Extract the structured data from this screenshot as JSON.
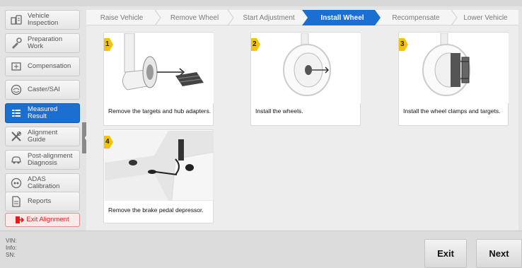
{
  "sidebar": {
    "items": [
      {
        "label": "Vehicle\nInspection",
        "icon": "vehicle-inspection-icon"
      },
      {
        "label": "Preparation\nWork",
        "icon": "preparation-icon"
      },
      {
        "label": "Compensation",
        "icon": "compensation-icon"
      },
      {
        "label": "Caster/SAI",
        "icon": "caster-icon"
      },
      {
        "label": "Measured\nResult",
        "icon": "measured-result-icon"
      },
      {
        "label": "Alignment\nGuide",
        "icon": "alignment-guide-icon"
      },
      {
        "label": "Post-alignment\nDiagnosis",
        "icon": "post-alignment-icon"
      },
      {
        "label": "ADAS\nCalibration",
        "icon": "adas-icon"
      },
      {
        "label": "Reports",
        "icon": "reports-icon"
      }
    ],
    "exit_label": "Exit Alignment",
    "active_index": 4
  },
  "steps": [
    "Raise Vehicle",
    "Remove Wheel",
    "Start Adjustment",
    "Install Wheel",
    "Recompensate",
    "Lower Vehicle"
  ],
  "active_step": 3,
  "cards": [
    {
      "number": "1",
      "text": "Remove the targets and hub adapters."
    },
    {
      "number": "2",
      "text": "Install the wheels."
    },
    {
      "number": "3",
      "text": "Install the wheel clamps and targets."
    },
    {
      "number": "4",
      "text": "Remove the brake pedal depressor."
    }
  ],
  "footer": {
    "vin_label": "VIN:",
    "info_label": "Info:",
    "sn_label": "SN:",
    "exit_button": "Exit",
    "next_button": "Next"
  },
  "colors": {
    "accent": "#1a6fd1",
    "badge": "#f4c400",
    "exit_red": "#e01c1c"
  }
}
